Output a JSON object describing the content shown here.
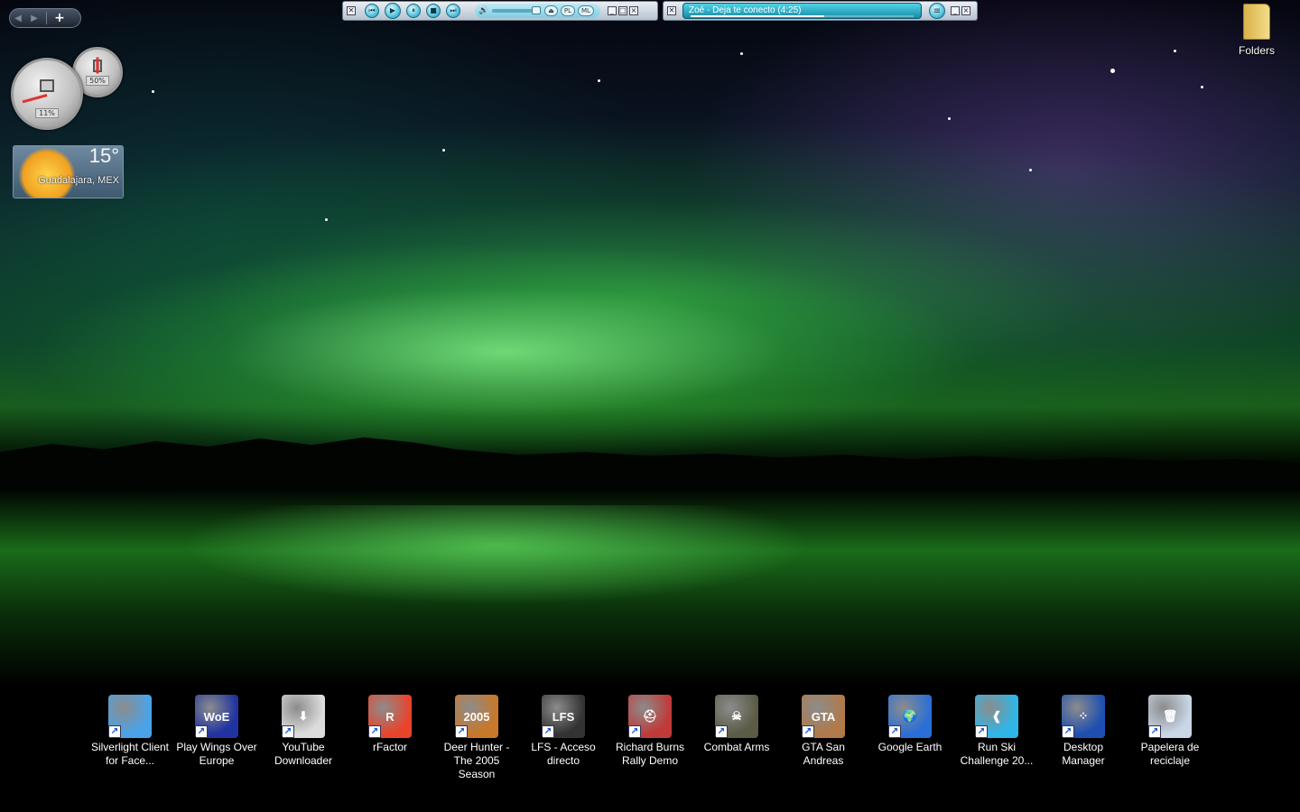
{
  "sidebar_nav": {
    "prev": "◀",
    "next": "▶",
    "add": "+"
  },
  "meter_gadget": {
    "cpu_readout": "11%",
    "memory_readout": "50%",
    "cpu_usage_percent": 11,
    "memory_usage_percent": 50
  },
  "weather": {
    "temperature": "15°",
    "city": "Guadalajara, MEX"
  },
  "media_player": {
    "controls": {
      "prev": "⏮",
      "play": "▶",
      "pause": "⏸",
      "stop": "■",
      "next": "⏭"
    },
    "volume_icon": "🔊",
    "pills": [
      "⏏",
      "PL",
      "ML"
    ],
    "window_buttons": [
      "_",
      "□",
      "×"
    ],
    "now_playing": "Zoé - Deja te conecto (4:25)",
    "progress_fraction": 0.6,
    "menu_icon": "≡"
  },
  "colors": {
    "player_accent": "#3fb9d8",
    "aurora_green": "#3cd83c"
  },
  "folders_label": "Folders",
  "desktop_icons": [
    {
      "label": "Silverlight Client for Face...",
      "icon": "silverlight-icon",
      "color": "#4aa3e8",
      "glyph": ""
    },
    {
      "label": "Play Wings Over Europe",
      "icon": "wings-over-europe-icon",
      "color": "#2033a0",
      "glyph": "WoE"
    },
    {
      "label": "YouTube Downloader",
      "icon": "youtube-downloader-icon",
      "color": "#dcdcdc",
      "glyph": "⬇"
    },
    {
      "label": "rFactor",
      "icon": "rfactor-icon",
      "color": "#e8442c",
      "glyph": "R"
    },
    {
      "label": "Deer Hunter - The 2005 Season",
      "icon": "deer-hunter-icon",
      "color": "#c8782a",
      "glyph": "2005"
    },
    {
      "label": "LFS - Acceso directo",
      "icon": "lfs-icon",
      "color": "#333333",
      "glyph": "LFS"
    },
    {
      "label": "Richard Burns Rally Demo",
      "icon": "richard-burns-rally-icon",
      "color": "#c03a3a",
      "glyph": "⛑"
    },
    {
      "label": "Combat Arms",
      "icon": "combat-arms-icon",
      "color": "#5b5b46",
      "glyph": "☠"
    },
    {
      "label": "GTA San Andreas",
      "icon": "gta-san-andreas-icon",
      "color": "#b07a4a",
      "glyph": "GTA"
    },
    {
      "label": "Google Earth",
      "icon": "google-earth-icon",
      "color": "#2a6fd6",
      "glyph": "🌍"
    },
    {
      "label": "Run Ski Challenge 20...",
      "icon": "ski-challenge-icon",
      "color": "#2fb6e8",
      "glyph": "❰"
    },
    {
      "label": "Desktop Manager",
      "icon": "blackberry-desktop-manager-icon",
      "color": "#1e4fb0",
      "glyph": "⁘"
    },
    {
      "label": "Papelera de reciclaje",
      "icon": "recycle-bin-icon",
      "color": "#c8d6e6",
      "glyph": "🗑"
    }
  ]
}
